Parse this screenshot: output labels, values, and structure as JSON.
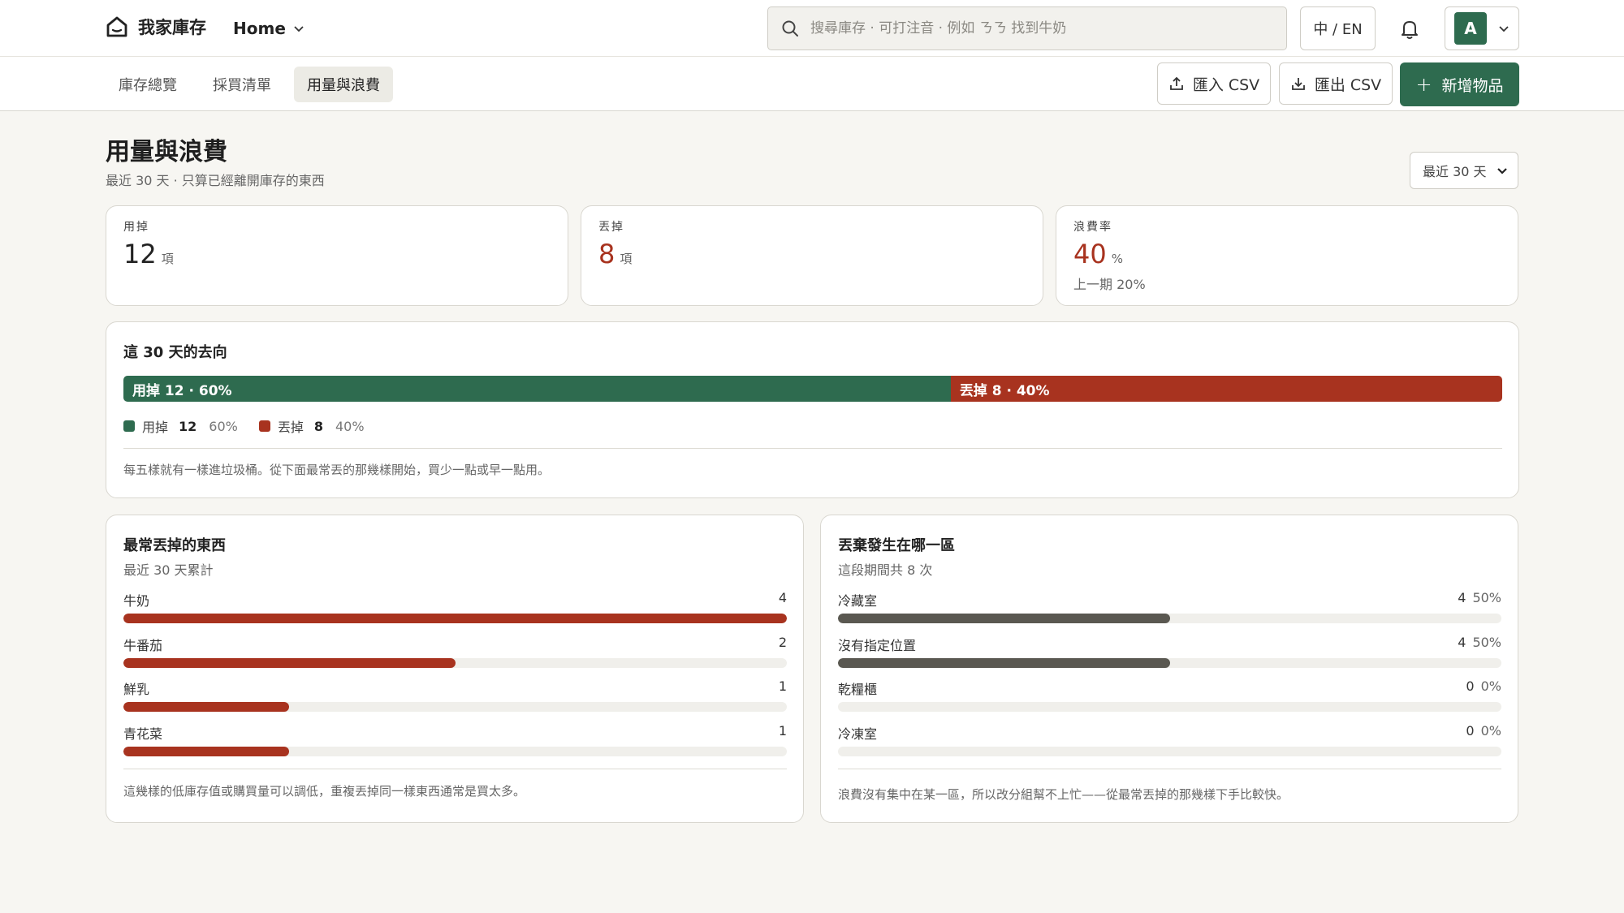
{
  "header": {
    "brand": "我家庫存",
    "home_menu": "Home",
    "search_placeholder": "搜尋庫存 · 可打注音 · 例如 ㄋㄋ 找到牛奶",
    "lang_toggle": "中 / EN",
    "avatar_initial": "A"
  },
  "nav": {
    "tabs": [
      {
        "label": "庫存總覽",
        "active": false
      },
      {
        "label": "採買清單",
        "active": false
      },
      {
        "label": "用量與浪費",
        "active": true
      }
    ],
    "import_csv": "匯入 CSV",
    "export_csv": "匯出 CSV",
    "add_item": "新增物品"
  },
  "page": {
    "title": "用量與浪費",
    "subtitle": "最近 30 天 · 只算已經離開庫存的東西",
    "period_selected": "最近 30 天"
  },
  "stats": {
    "used": {
      "label": "用掉",
      "value": "12",
      "unit": "項"
    },
    "thrown": {
      "label": "丟掉",
      "value": "8",
      "unit": "項"
    },
    "waste_rate": {
      "label": "浪費率",
      "value": "40",
      "unit": "%",
      "previous": "上一期 20%"
    }
  },
  "flow": {
    "title": "這 30 天的去向",
    "used_segment_label": "用掉 12 · 60%",
    "thrown_segment_label": "丟掉 8 · 40%",
    "used_fraction": 0.6,
    "thrown_fraction": 0.4,
    "legend": {
      "used_label": "用掉",
      "used_count": "12",
      "used_pct": "60%",
      "thrown_label": "丟掉",
      "thrown_count": "8",
      "thrown_pct": "40%"
    },
    "note": "每五樣就有一樣進垃圾桶。從下面最常丟的那幾樣開始，買少一點或早一點用。"
  },
  "most_thrown": {
    "title": "最常丟掉的東西",
    "subtitle": "最近 30 天累計",
    "max": 4,
    "items": [
      {
        "name": "牛奶",
        "count": 4
      },
      {
        "name": "牛番茄",
        "count": 2
      },
      {
        "name": "鮮乳",
        "count": 1
      },
      {
        "name": "青花菜",
        "count": 1
      }
    ],
    "note": "這幾樣的低庫存值或購買量可以調低，重複丟掉同一樣東西通常是買太多。"
  },
  "by_location": {
    "title": "丟棄發生在哪一區",
    "subtitle": "這段期間共 8 次",
    "items": [
      {
        "name": "冷藏室",
        "count": 4,
        "pct": "50%",
        "fraction": 0.5
      },
      {
        "name": "沒有指定位置",
        "count": 4,
        "pct": "50%",
        "fraction": 0.5
      },
      {
        "name": "乾糧櫃",
        "count": 0,
        "pct": "0%",
        "fraction": 0
      },
      {
        "name": "冷凍室",
        "count": 0,
        "pct": "0%",
        "fraction": 0
      }
    ],
    "note": "浪費沒有集中在某一區，所以改分組幫不上忙——從最常丟掉的那幾樣下手比較快。"
  },
  "colors": {
    "accent_green": "#2e6b4f",
    "waste_red": "#a8331f",
    "location_gray": "#5a5851"
  }
}
